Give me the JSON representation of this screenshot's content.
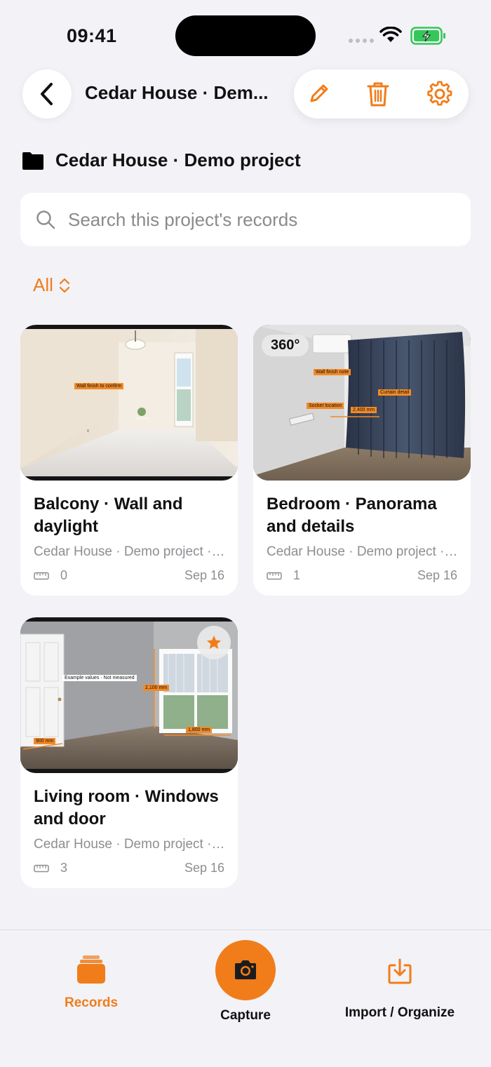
{
  "status_bar": {
    "time": "09:41"
  },
  "nav": {
    "title": "Cedar House · Dem...",
    "actions": [
      "pencil-icon",
      "trash-icon",
      "gear-icon"
    ]
  },
  "project": {
    "title": "Cedar House · Demo project"
  },
  "search": {
    "placeholder": "Search this project's records",
    "value": ""
  },
  "filter": {
    "label": "All"
  },
  "records": [
    {
      "title": "Balcony · Wall and daylight",
      "project": "Cedar House · Demo project · Balcony",
      "measurements": "0",
      "date": "Sep 16",
      "annotations": [
        "Wall finish to confirm"
      ]
    },
    {
      "title": "Bedroom · Panorama and details",
      "project": "Cedar House · Demo project · Bedroom",
      "measurements": "1",
      "date": "Sep 16",
      "badge": "360°",
      "annotations": [
        "Wall finish note",
        "Curtain detail",
        "Socket location",
        "2,400 mm"
      ]
    },
    {
      "title": "Living room · Windows and door",
      "project": "Cedar House · Demo project · Living room",
      "measurements": "3",
      "date": "Sep 16",
      "starred": true,
      "annotations": [
        "Example values · Not measured",
        "2,100 mm",
        "1,800 mm",
        "900 mm"
      ]
    }
  ],
  "tabs": [
    {
      "label": "Records",
      "icon": "records-stack-icon",
      "active": true
    },
    {
      "label": "Capture",
      "icon": "camera-icon"
    },
    {
      "label": "Import / Organize",
      "icon": "import-tray-icon"
    }
  ],
  "colors": {
    "accent": "#f07d1a",
    "background": "#f2f2f7",
    "card": "#ffffff",
    "secondary_text": "#8e8e93"
  }
}
